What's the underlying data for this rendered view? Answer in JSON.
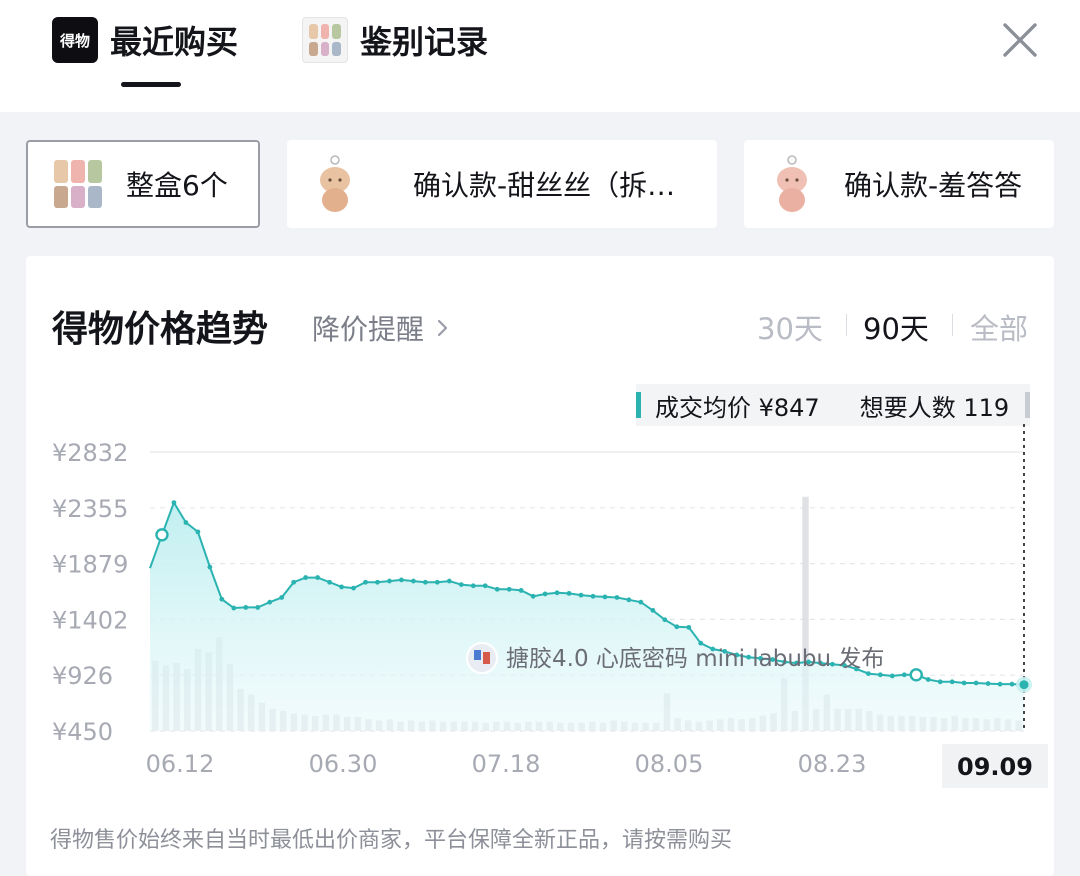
{
  "tabs": [
    {
      "label": "最近购买",
      "icon": "dewu-logo-icon",
      "logo_text": "得物",
      "active": true
    },
    {
      "label": "鉴别记录",
      "icon": "figures-thumbnail-icon",
      "active": false
    }
  ],
  "close_icon": "close-icon",
  "chips": [
    {
      "label": "整盒6个",
      "selected": true,
      "icon": "box-set-thumbnail-icon"
    },
    {
      "label": "确认款-甜丝丝（拆…",
      "selected": false,
      "icon": "figure-thumbnail-icon"
    },
    {
      "label": "确认款-羞答答",
      "selected": false,
      "icon": "figure-thumbnail-icon"
    }
  ],
  "card": {
    "title": "得物价格趋势",
    "alert_label": "降价提醒",
    "ranges": [
      {
        "label": "30天",
        "active": false
      },
      {
        "label": "90天",
        "active": true
      },
      {
        "label": "全部",
        "active": false
      }
    ],
    "summary": {
      "avg_label": "成交均价 ¥847",
      "want_label": "想要人数 119"
    },
    "footnote": "得物售价始终来自当时最低出价商家，平台保障全新正品，请按需购买"
  },
  "colors": {
    "accent": "#2bb3b1",
    "text": "#14151a",
    "muted": "#7b7e88",
    "inactive": "#b9bcc4"
  },
  "chart_data": {
    "type": "line",
    "y_ticks": [
      "¥2832",
      "¥2355",
      "¥1879",
      "¥1402",
      "¥926",
      "¥450"
    ],
    "ylim": [
      450,
      2832
    ],
    "x_ticks": [
      "06.12",
      "06.30",
      "07.18",
      "08.05",
      "08.23",
      "09.09"
    ],
    "selected_x": "09.09",
    "event_annotation": "搪胶4.0 心底密码 mini labubu 发布",
    "grid": true,
    "series": [
      {
        "type": "line",
        "values": [
          1840,
          2125,
          2400,
          2230,
          2150,
          1850,
          1575,
          1500,
          1505,
          1505,
          1550,
          1590,
          1720,
          1760,
          1760,
          1720,
          1680,
          1670,
          1720,
          1720,
          1730,
          1740,
          1730,
          1720,
          1720,
          1730,
          1700,
          1690,
          1690,
          1660,
          1660,
          1650,
          1600,
          1620,
          1630,
          1625,
          1610,
          1600,
          1595,
          1590,
          1570,
          1550,
          1480,
          1400,
          1340,
          1335,
          1200,
          1150,
          1130,
          1100,
          1080,
          1070,
          1060,
          1040,
          1030,
          1040,
          1030,
          1020,
          1010,
          980,
          940,
          930,
          920,
          930,
          930,
          890,
          870,
          870,
          860,
          860,
          855,
          850,
          850,
          845
        ]
      },
      {
        "type": "bar",
        "values": [
          1050,
          1010,
          1030,
          980,
          1150,
          1120,
          1250,
          1020,
          810,
          760,
          690,
          640,
          620,
          600,
          590,
          580,
          590,
          590,
          570,
          570,
          550,
          540,
          550,
          530,
          540,
          530,
          540,
          530,
          530,
          530,
          530,
          520,
          530,
          530,
          520,
          530,
          530,
          530,
          520,
          520,
          520,
          530,
          520,
          540,
          530,
          520,
          520,
          520,
          770,
          560,
          540,
          530,
          540,
          550,
          560,
          550,
          560,
          580,
          600,
          900,
          620,
          2450,
          640,
          760,
          640,
          640,
          640,
          620,
          590,
          580,
          580,
          580,
          570,
          570,
          560,
          580,
          560,
          560,
          550,
          560,
          550,
          540
        ]
      }
    ]
  }
}
